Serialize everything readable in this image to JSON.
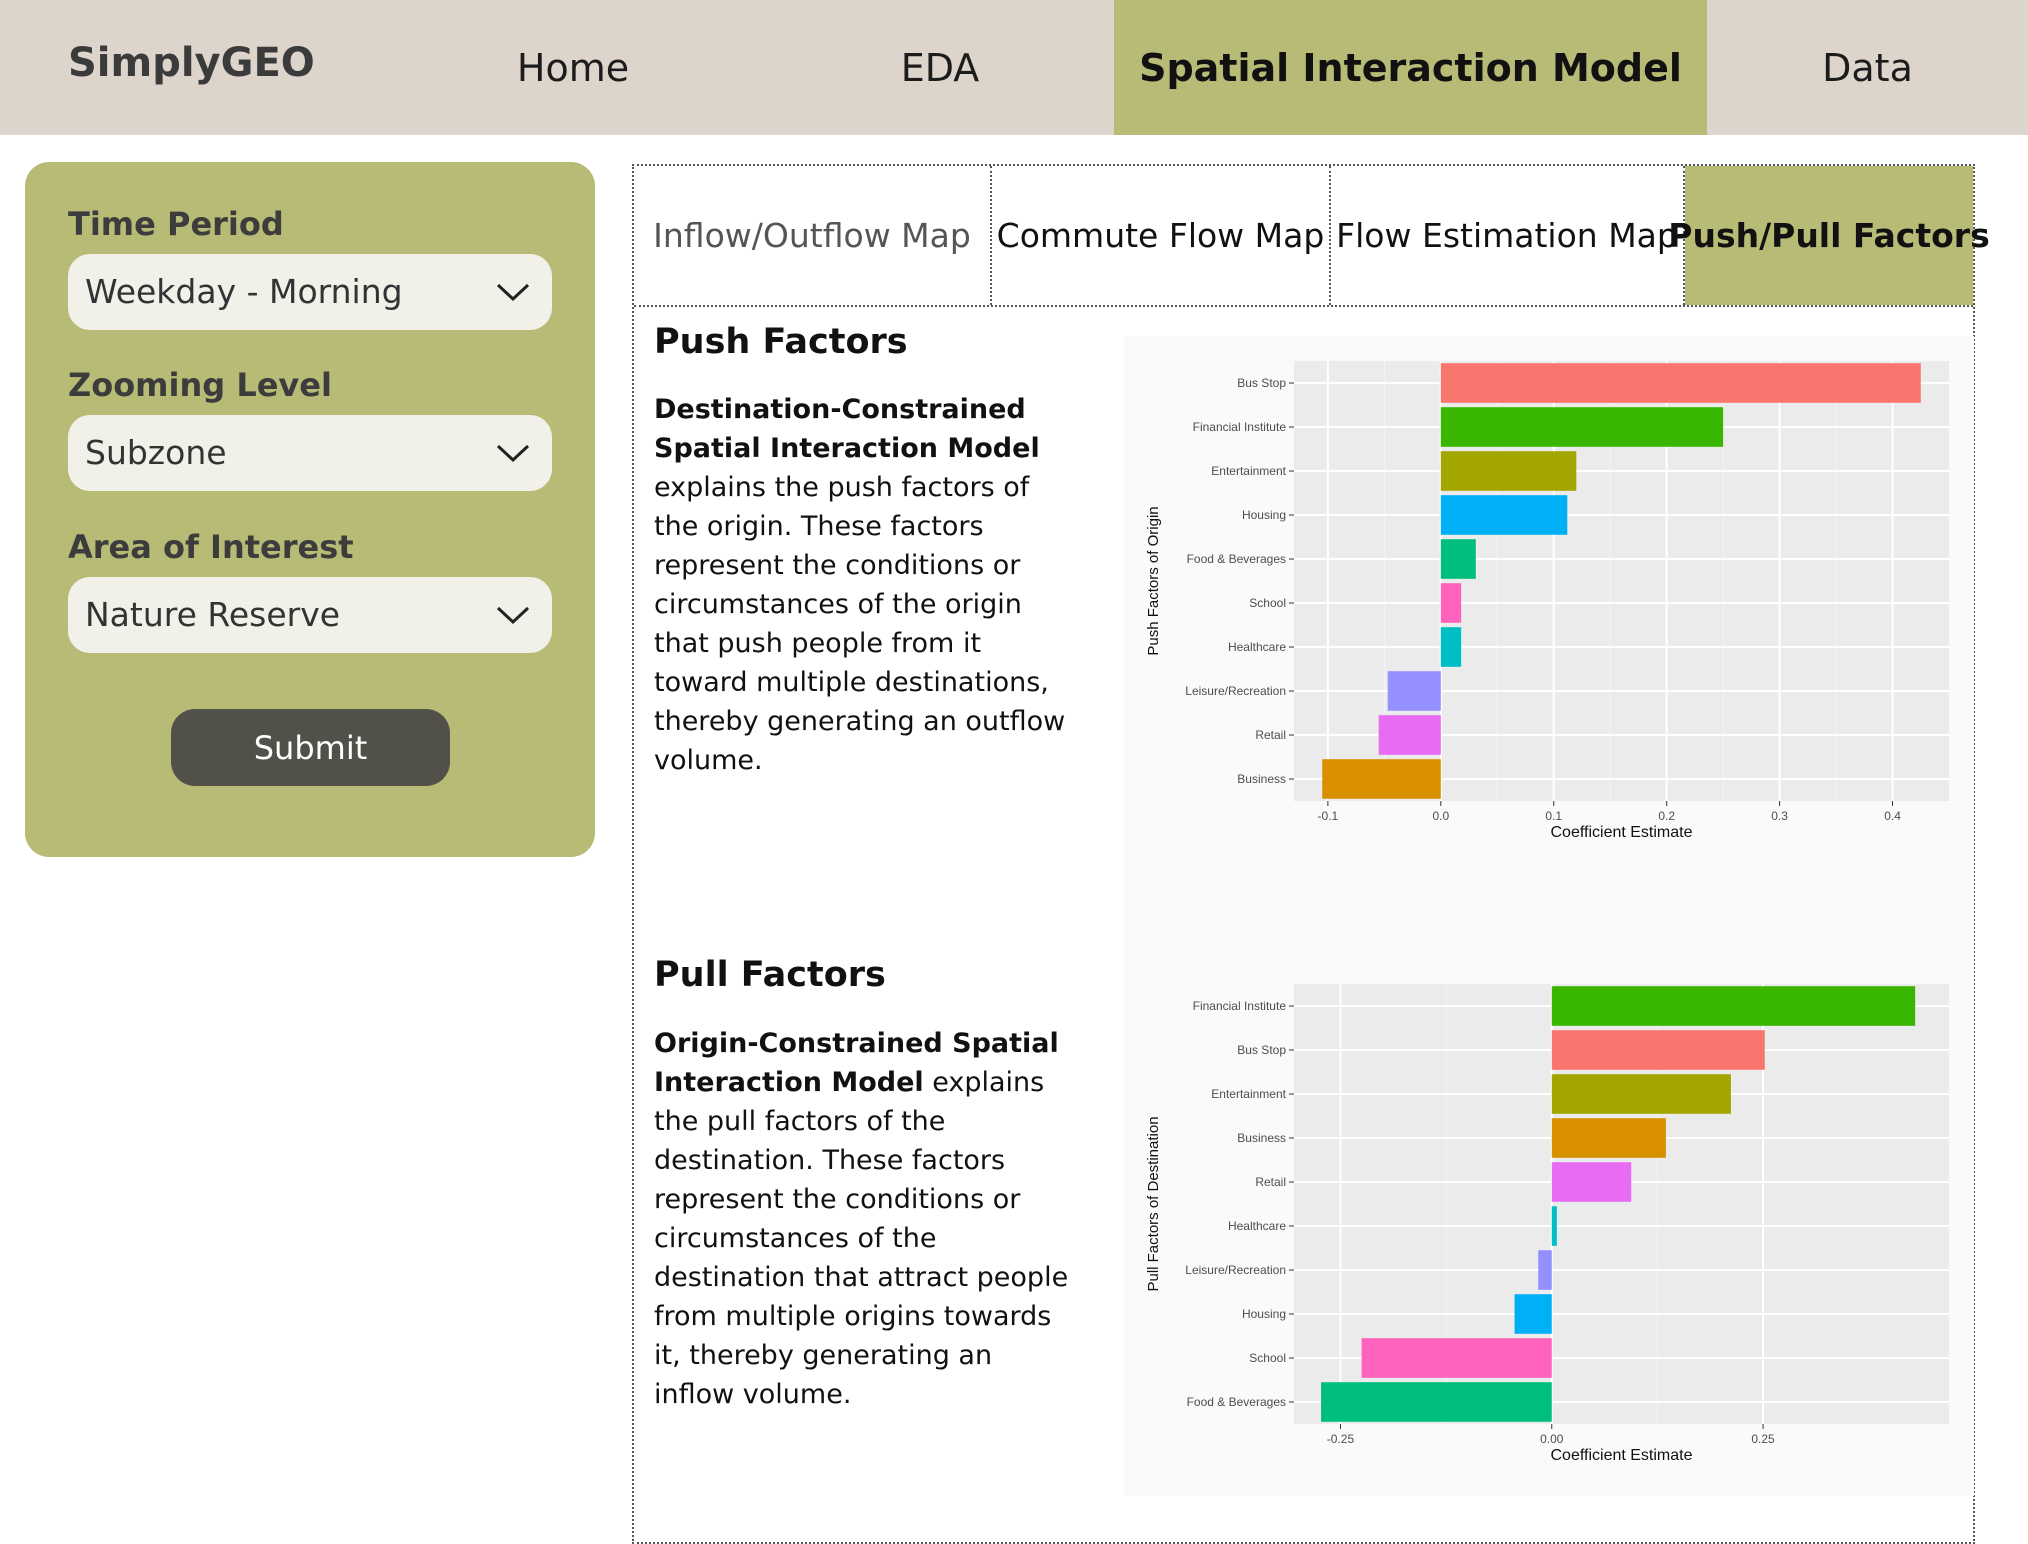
{
  "nav": {
    "brand": "SimplyGEO",
    "items": [
      "Home",
      "EDA",
      "Spatial Interaction Model",
      "Data"
    ],
    "active": "Spatial Interaction Model"
  },
  "sidebar": {
    "time_period": {
      "label": "Time Period",
      "value": "Weekday - Morning"
    },
    "zoom_level": {
      "label": "Zooming Level",
      "value": "Subzone"
    },
    "area_of_interest": {
      "label": "Area of Interest",
      "value": "Nature Reserve"
    },
    "submit_label": "Submit"
  },
  "tabs": {
    "items": [
      "Inflow/Outflow Map",
      "Commute Flow Map",
      "Flow Estimation Map",
      "Push/Pull Factors"
    ],
    "active": "Push/Pull Factors"
  },
  "push": {
    "title": "Push Factors",
    "desc_bold": "Destination-Constrained Spatial Interaction Model",
    "desc_rest": " explains the push factors of the origin. These factors represent the conditions or circumstances of the origin that push people from it toward multiple destinations, thereby generating an outflow volume."
  },
  "pull": {
    "title": "Pull Factors",
    "desc_bold": "Origin-Constrained Spatial Interaction Model",
    "desc_rest": " explains the pull factors of the destination. These factors represent the conditions or circumstances of the destination that attract people from multiple origins towards it, thereby generating an inflow volume."
  },
  "chart_data": [
    {
      "type": "bar",
      "orientation": "horizontal",
      "title": "",
      "xlabel": "Coefficient Estimate",
      "ylabel": "Push Factors of Origin",
      "categories": [
        "Bus Stop",
        "Financial Institute",
        "Entertainment",
        "Housing",
        "Food & Beverages",
        "School",
        "Healthcare",
        "Leisure/Recreation",
        "Retail",
        "Business"
      ],
      "values": [
        0.425,
        0.25,
        0.12,
        0.112,
        0.031,
        0.018,
        0.018,
        -0.047,
        -0.055,
        -0.105
      ],
      "colors": [
        "#F8766D",
        "#39B600",
        "#A3A500",
        "#00B0F6",
        "#00BF7D",
        "#FF62BC",
        "#00BFC4",
        "#9590FF",
        "#E76BF3",
        "#D89000"
      ],
      "xlim": [
        -0.13,
        0.45
      ],
      "xticks": [
        -0.1,
        0.0,
        0.1,
        0.2,
        0.3,
        0.4
      ],
      "xtick_labels": [
        "-0.1",
        "0.0",
        "0.1",
        "0.2",
        "0.3",
        "0.4"
      ],
      "grid": true
    },
    {
      "type": "bar",
      "orientation": "horizontal",
      "title": "",
      "xlabel": "Coefficient Estimate",
      "ylabel": "Pull Factors of Destination",
      "categories": [
        "Financial Institute",
        "Bus Stop",
        "Entertainment",
        "Business",
        "Retail",
        "Healthcare",
        "Leisure/Recreation",
        "Housing",
        "School",
        "Food & Beverages"
      ],
      "values": [
        0.43,
        0.252,
        0.212,
        0.135,
        0.094,
        0.006,
        -0.016,
        -0.044,
        -0.225,
        -0.273
      ],
      "colors": [
        "#39B600",
        "#F8766D",
        "#A3A500",
        "#D89000",
        "#E76BF3",
        "#00BFC4",
        "#9590FF",
        "#00B0F6",
        "#FF62BC",
        "#00BF7D"
      ],
      "xlim": [
        -0.305,
        0.47
      ],
      "xticks": [
        -0.25,
        0.0,
        0.25
      ],
      "xtick_labels": [
        "-0.25",
        "0.00",
        "0.25"
      ],
      "grid": true
    }
  ]
}
